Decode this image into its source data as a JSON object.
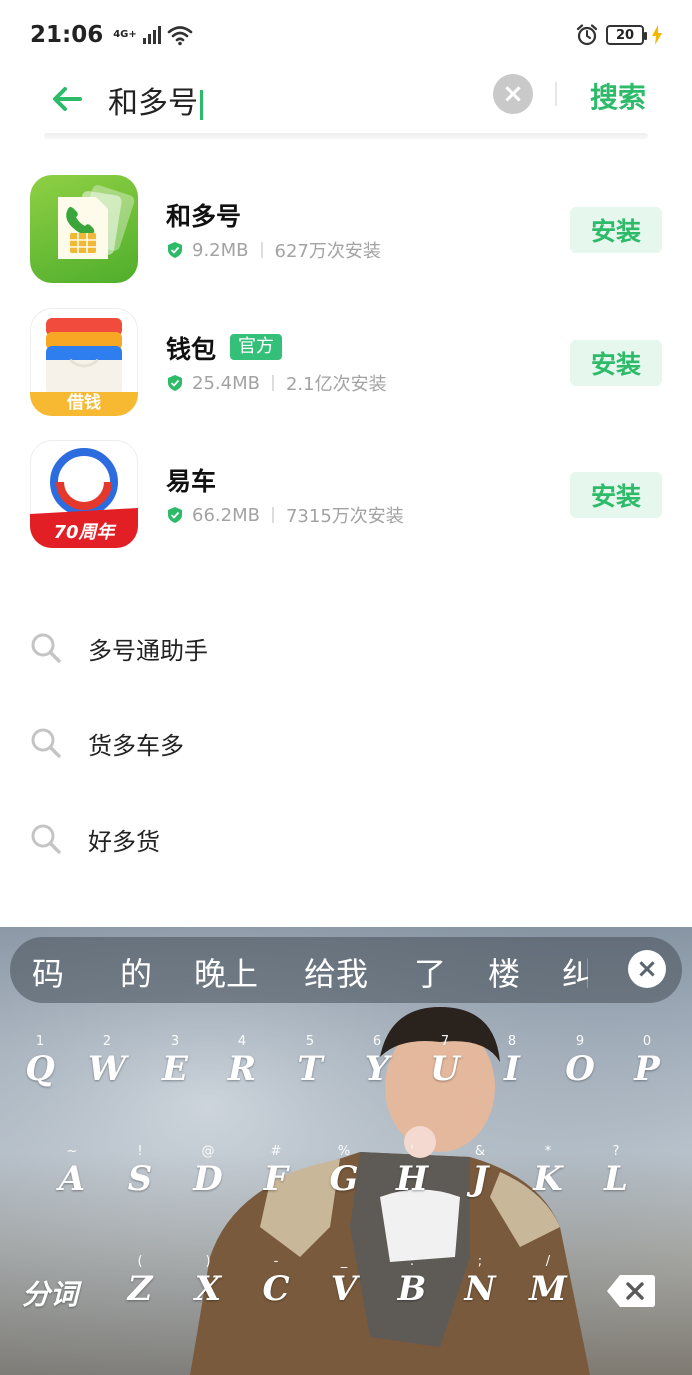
{
  "status_bar": {
    "time": "21:06",
    "network": "4G+",
    "battery": "20"
  },
  "search": {
    "query": "和多号",
    "submit_label": "搜索"
  },
  "apps": [
    {
      "name": "和多号",
      "size": "9.2MB",
      "installs": "627万次安装",
      "button": "安装",
      "badge": ""
    },
    {
      "name": "钱包",
      "size": "25.4MB",
      "installs": "2.1亿次安装",
      "button": "安装",
      "badge": "官方",
      "icon_caption": "借钱"
    },
    {
      "name": "易车",
      "size": "66.2MB",
      "installs": "7315万次安装",
      "button": "安装",
      "badge": "",
      "icon_caption": "70周年"
    }
  ],
  "suggestions": [
    "多号通助手",
    "货多车多",
    "好多货"
  ],
  "keyboard": {
    "candidates": [
      "码",
      "的",
      "晚上",
      "给我",
      "了",
      "楼",
      "纠"
    ],
    "row1": [
      {
        "k": "Q",
        "h": "1"
      },
      {
        "k": "W",
        "h": "2"
      },
      {
        "k": "E",
        "h": "3"
      },
      {
        "k": "R",
        "h": "4"
      },
      {
        "k": "T",
        "h": "5"
      },
      {
        "k": "Y",
        "h": "6"
      },
      {
        "k": "U",
        "h": "7"
      },
      {
        "k": "I",
        "h": "8"
      },
      {
        "k": "O",
        "h": "9"
      },
      {
        "k": "P",
        "h": "0"
      }
    ],
    "row2": [
      {
        "k": "A",
        "h": "~"
      },
      {
        "k": "S",
        "h": "!"
      },
      {
        "k": "D",
        "h": "@"
      },
      {
        "k": "F",
        "h": "#"
      },
      {
        "k": "G",
        "h": "%"
      },
      {
        "k": "H",
        "h": "'"
      },
      {
        "k": "J",
        "h": "&"
      },
      {
        "k": "K",
        "h": "*"
      },
      {
        "k": "L",
        "h": "?"
      }
    ],
    "row3": [
      {
        "k": "Z",
        "h": "("
      },
      {
        "k": "X",
        "h": ")"
      },
      {
        "k": "C",
        "h": "-"
      },
      {
        "k": "V",
        "h": "_"
      },
      {
        "k": "B",
        "h": ":"
      },
      {
        "k": "N",
        "h": ";"
      },
      {
        "k": "M",
        "h": "/"
      }
    ],
    "fenci_label": "分词"
  },
  "colors": {
    "accent": "#2dbb6a",
    "install_bg": "#e6f7ee",
    "badge_bg": "#35c07a"
  }
}
